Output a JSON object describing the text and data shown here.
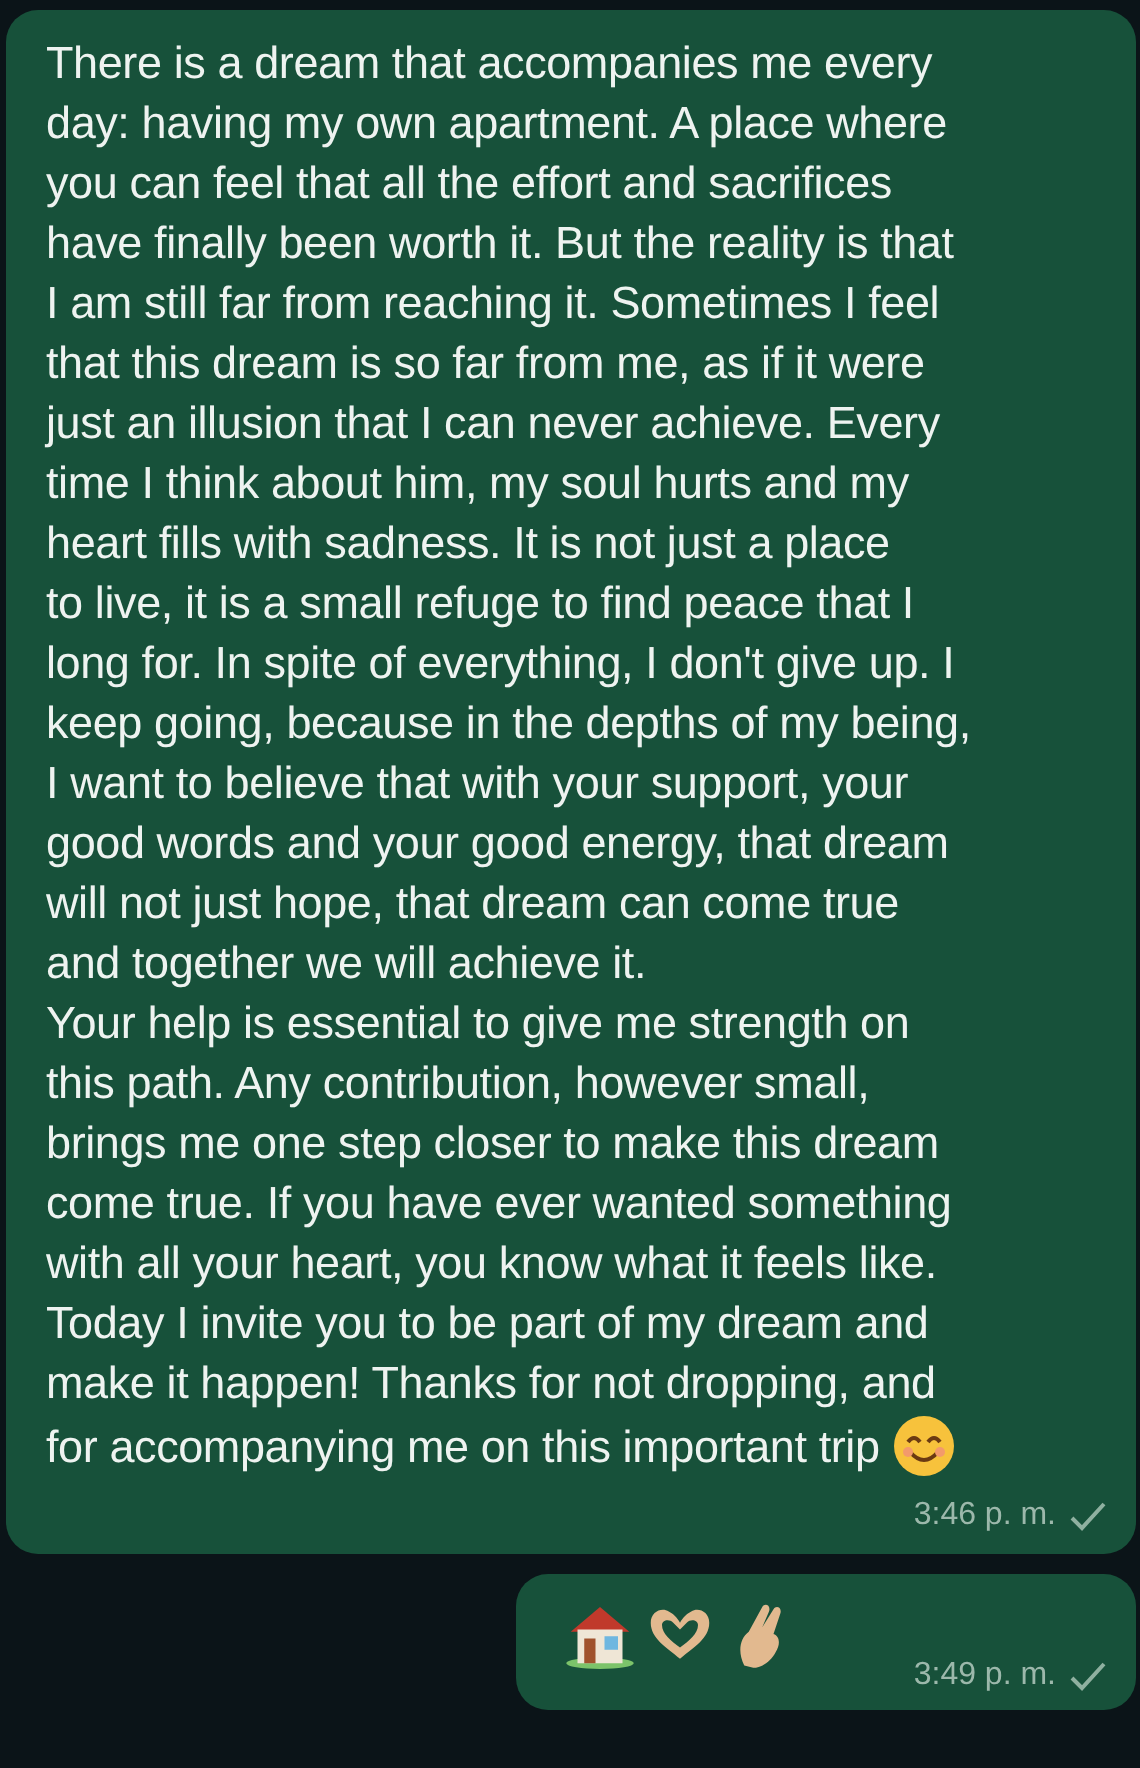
{
  "messages": [
    {
      "paragraphs": [
        "There is a dream that accompanies me every\nday: having my own apartment. A place where\nyou can feel that all the effort and sacrifices\nhave finally been worth it. But the reality is that\nI am still far from reaching it. Sometimes I feel\nthat this dream is so far from me, as if it were\njust an illusion that I can never achieve. Every\ntime I think about him, my soul hurts and my\nheart fills with sadness. It is not just a place\nto live, it is a small refuge to find peace that I\nlong for. In spite of everything, I don't give up. I\nkeep going, because in the depths of my being,\nI want to believe that with your support, your\ngood words and your good energy, that dream\nwill not just hope, that dream can come true\nand together we will achieve it.",
        "Your help is essential to give me strength on\nthis path. Any contribution, however small,\nbrings me one step closer to make this dream\ncome true. If you have ever wanted something\nwith all your heart, you know what it feels like.\nToday I invite you to be part of my dream and\nmake it happen! Thanks for not dropping, and\nfor accompanying me on this important trip"
      ],
      "kind": "text",
      "time": "3:46 p. m.",
      "delivered": true
    },
    {
      "kind": "emoji",
      "time": "3:49 p. m.",
      "delivered": true
    }
  ]
}
